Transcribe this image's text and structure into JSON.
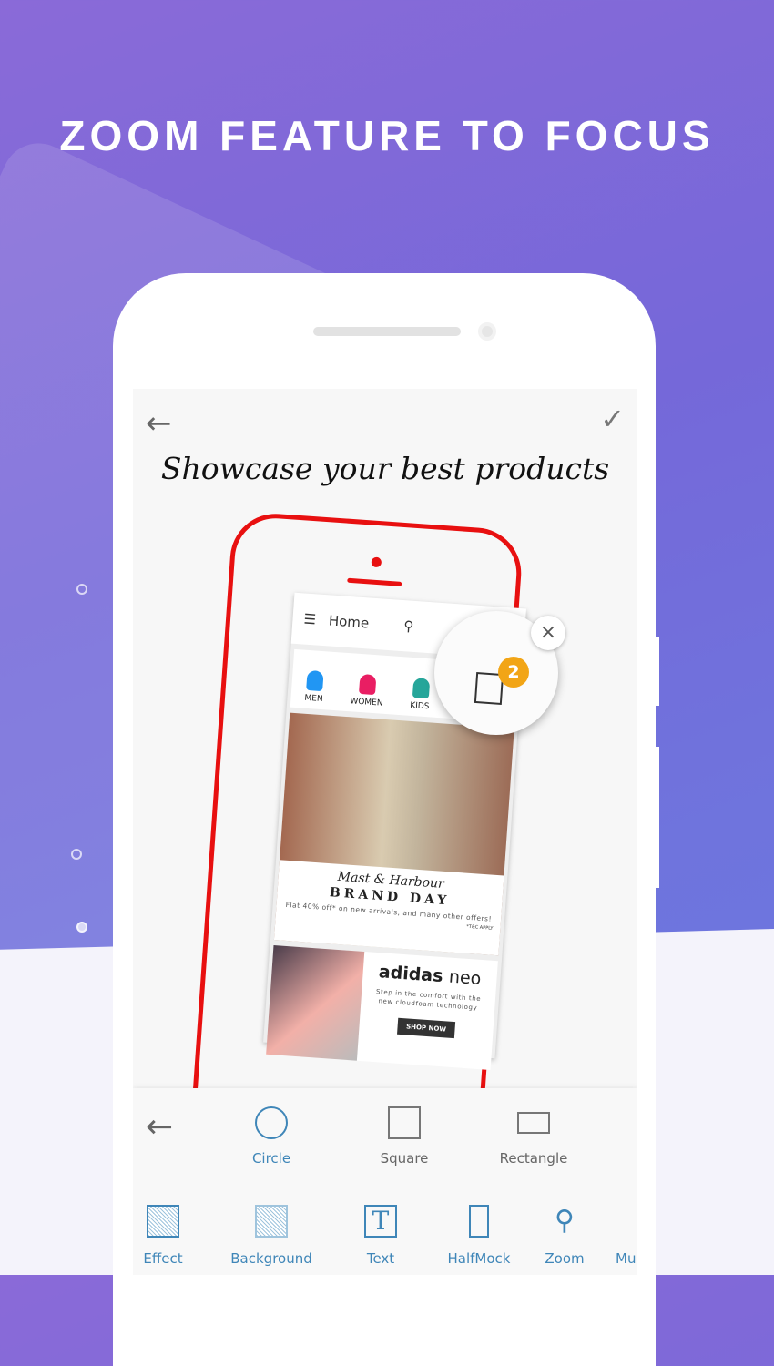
{
  "headline": "ZOOM FEATURE TO FOCUS",
  "editor": {
    "title": "Showcase your best products",
    "back_icon": "arrow-left-icon",
    "confirm_icon": "check-icon"
  },
  "mockup_app": {
    "appbar_title": "Home",
    "categories": [
      {
        "label": "MEN",
        "color": "#2196f3"
      },
      {
        "label": "WOMEN",
        "color": "#e91e63"
      },
      {
        "label": "KIDS",
        "color": "#26a69a"
      }
    ],
    "banner": {
      "script": "Mast & Harbour",
      "title": "BRAND DAY",
      "offer": "Flat 40% off* on new arrivals, and many other offers!",
      "tc": "*T&C APPLY"
    },
    "promo": {
      "brand": "adidas",
      "brand_suffix": "neo",
      "line1": "Step in the comfort with the",
      "line2": "new cloudfoam technology",
      "cta": "SHOP NOW"
    },
    "cart_badge": "2",
    "frame_color": "#e81010"
  },
  "zoom_close": "×",
  "shapes": [
    {
      "label": "Circle",
      "active": true
    },
    {
      "label": "Square",
      "active": false
    },
    {
      "label": "Rectangle",
      "active": false
    }
  ],
  "tools": [
    {
      "label": "Effect"
    },
    {
      "label": "Background"
    },
    {
      "label": "Text",
      "glyph": "T"
    },
    {
      "label": "HalfMock"
    },
    {
      "label": "Zoom"
    },
    {
      "label": "Mu"
    }
  ],
  "colors": {
    "accent": "#3f86b8",
    "frame": "#e81010",
    "badge": "#f2a516"
  }
}
